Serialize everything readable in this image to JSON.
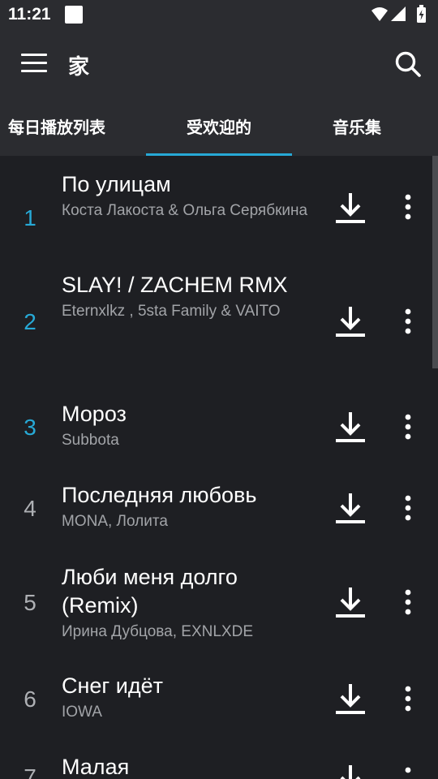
{
  "status": {
    "time": "11:21"
  },
  "header": {
    "title": "家"
  },
  "tabs": [
    {
      "label": "每日播放列表"
    },
    {
      "label": "受欢迎的"
    },
    {
      "label": "音乐集"
    }
  ],
  "active_tab": 1,
  "songs": [
    {
      "rank": "1",
      "title": "По улицам",
      "artist": "Коста Лакоста   &  Ольга Серябкина"
    },
    {
      "rank": "2",
      "title": "SLAY! / ZACHEM RMX",
      "artist": "Eternxlkz ,  5sta Family   &  VAITO"
    },
    {
      "rank": "3",
      "title": "Мороз",
      "artist": "Subbota"
    },
    {
      "rank": "4",
      "title": "Последняя любовь",
      "artist": "MONA, Лолита"
    },
    {
      "rank": "5",
      "title": "Люби меня долго (Remix)",
      "artist": "Ирина Дубцова, EXNLXDE"
    },
    {
      "rank": "6",
      "title": "Снег идёт",
      "artist": "IOWA"
    },
    {
      "rank": "7",
      "title": "Малая",
      "artist": ""
    }
  ],
  "colors": {
    "accent": "#27a9d6",
    "background": "#1e1f23",
    "bar": "#2b2c30",
    "secondary_text": "#a2a4a8"
  }
}
